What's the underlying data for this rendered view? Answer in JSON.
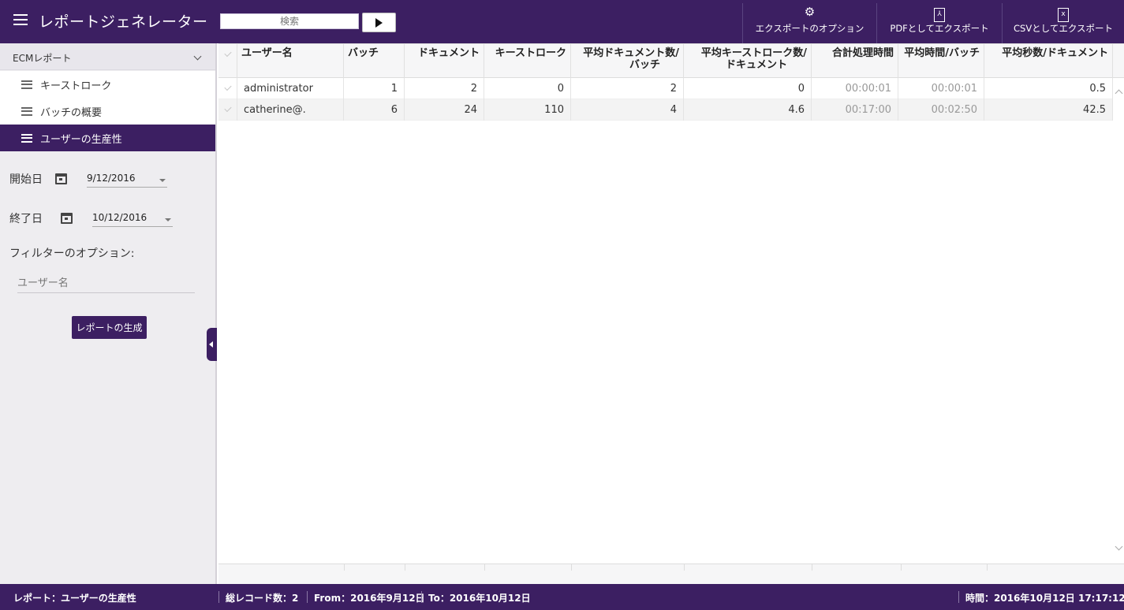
{
  "header": {
    "title": "レポートジェネレーター",
    "search_placeholder": "検索",
    "export_options_label": "エクスポートのオプション",
    "export_pdf_label": "PDFとしてエクスポート",
    "export_csv_label": "CSVとしてエクスポート",
    "icons": {
      "menu": "hamburger-icon",
      "run": "play-icon",
      "options": "gear-icon",
      "pdf": "pdf-file-icon",
      "csv": "excel-file-icon"
    }
  },
  "sidebar": {
    "group_label": "ECMレポート",
    "items": [
      {
        "label": "キーストローク",
        "active": false
      },
      {
        "label": "バッチの概要",
        "active": false
      },
      {
        "label": "ユーザーの生産性",
        "active": true
      }
    ],
    "start_label": "開始日",
    "start_value": "9/12/2016",
    "end_label": "終了日",
    "end_value": "10/12/2016",
    "filter_label": "フィルターのオプション:",
    "user_placeholder": "ユーザー名",
    "generate_label": "レポートの生成"
  },
  "table": {
    "columns": [
      "ユーザー名",
      "バッチ",
      "ドキュメント",
      "キーストローク",
      "平均ドキュメント数/バッチ",
      "平均キーストローク数/ドキュメント",
      "合計処理時間",
      "平均時間/バッチ",
      "平均秒数/ドキュメント"
    ],
    "col_1": "ユーザー名",
    "col_2": "バッチ",
    "col_3": "ドキュメント",
    "col_4": "キーストローク",
    "col_5a": "平均ドキュメント数/",
    "col_5b": "バッチ",
    "col_6a": "平均キーストローク数/",
    "col_6b": "ドキュメント",
    "col_7": "合計処理時間",
    "col_8": "平均時間/バッチ",
    "col_9": "平均秒数/ドキュメント",
    "rows": [
      [
        "administrator",
        "1",
        "2",
        "0",
        "2",
        "0",
        "00:00:01",
        "00:00:01",
        "0.5"
      ],
      [
        "catherine@.",
        "6",
        "24",
        "110",
        "4",
        "4.6",
        "00:17:00",
        "00:02:50",
        "42.5"
      ]
    ]
  },
  "status": {
    "report": "レポート：ユーザーの生産性",
    "total": "総レコード数：2",
    "from": "From：2016年9月12日",
    "to": "To：2016年10月12日",
    "time": "時間：2016年10月12日 17:17:12"
  },
  "colors": {
    "brand": "#3c1f62",
    "sidebar_bg": "#eeedf0"
  }
}
